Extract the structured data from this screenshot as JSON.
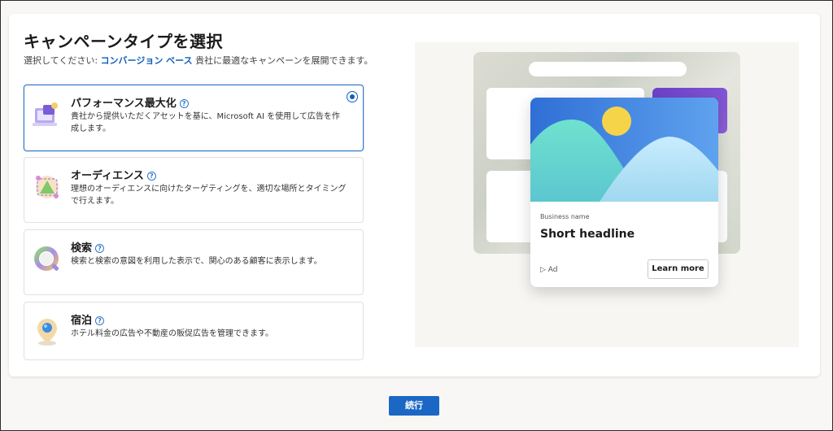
{
  "page": {
    "title": "キャンペーンタイプを選択",
    "subtitle_prefix": "選択してください: ",
    "subtitle_highlight": "コンバージョン ベース",
    "subtitle_suffix": " 貴社に最適なキャンペーンを展開できます。"
  },
  "options": [
    {
      "title": "パフォーマンス最大化",
      "description": "貴社から提供いただくアセットを基に、Microsoft AI を使用して広告を作成します。",
      "selected": true
    },
    {
      "title": "オーディエンス",
      "description": "理想のオーディエンスに向けたターゲティングを、適切な場所とタイミングで行えます。",
      "selected": false
    },
    {
      "title": "検索",
      "description": "検索と検索の意図を利用した表示で、関心のある顧客に表示します。",
      "selected": false
    },
    {
      "title": "宿泊",
      "description": "ホテル料金の広告や不動産の販促広告を管理できます。",
      "selected": false
    }
  ],
  "preview": {
    "business_name": "Business name",
    "headline": "Short headline",
    "ad_tag": "Ad",
    "cta_label": "Learn more"
  },
  "footer": {
    "continue_label": "続行"
  },
  "colors": {
    "accent": "#0f5fbd",
    "button": "#1a68c4"
  }
}
